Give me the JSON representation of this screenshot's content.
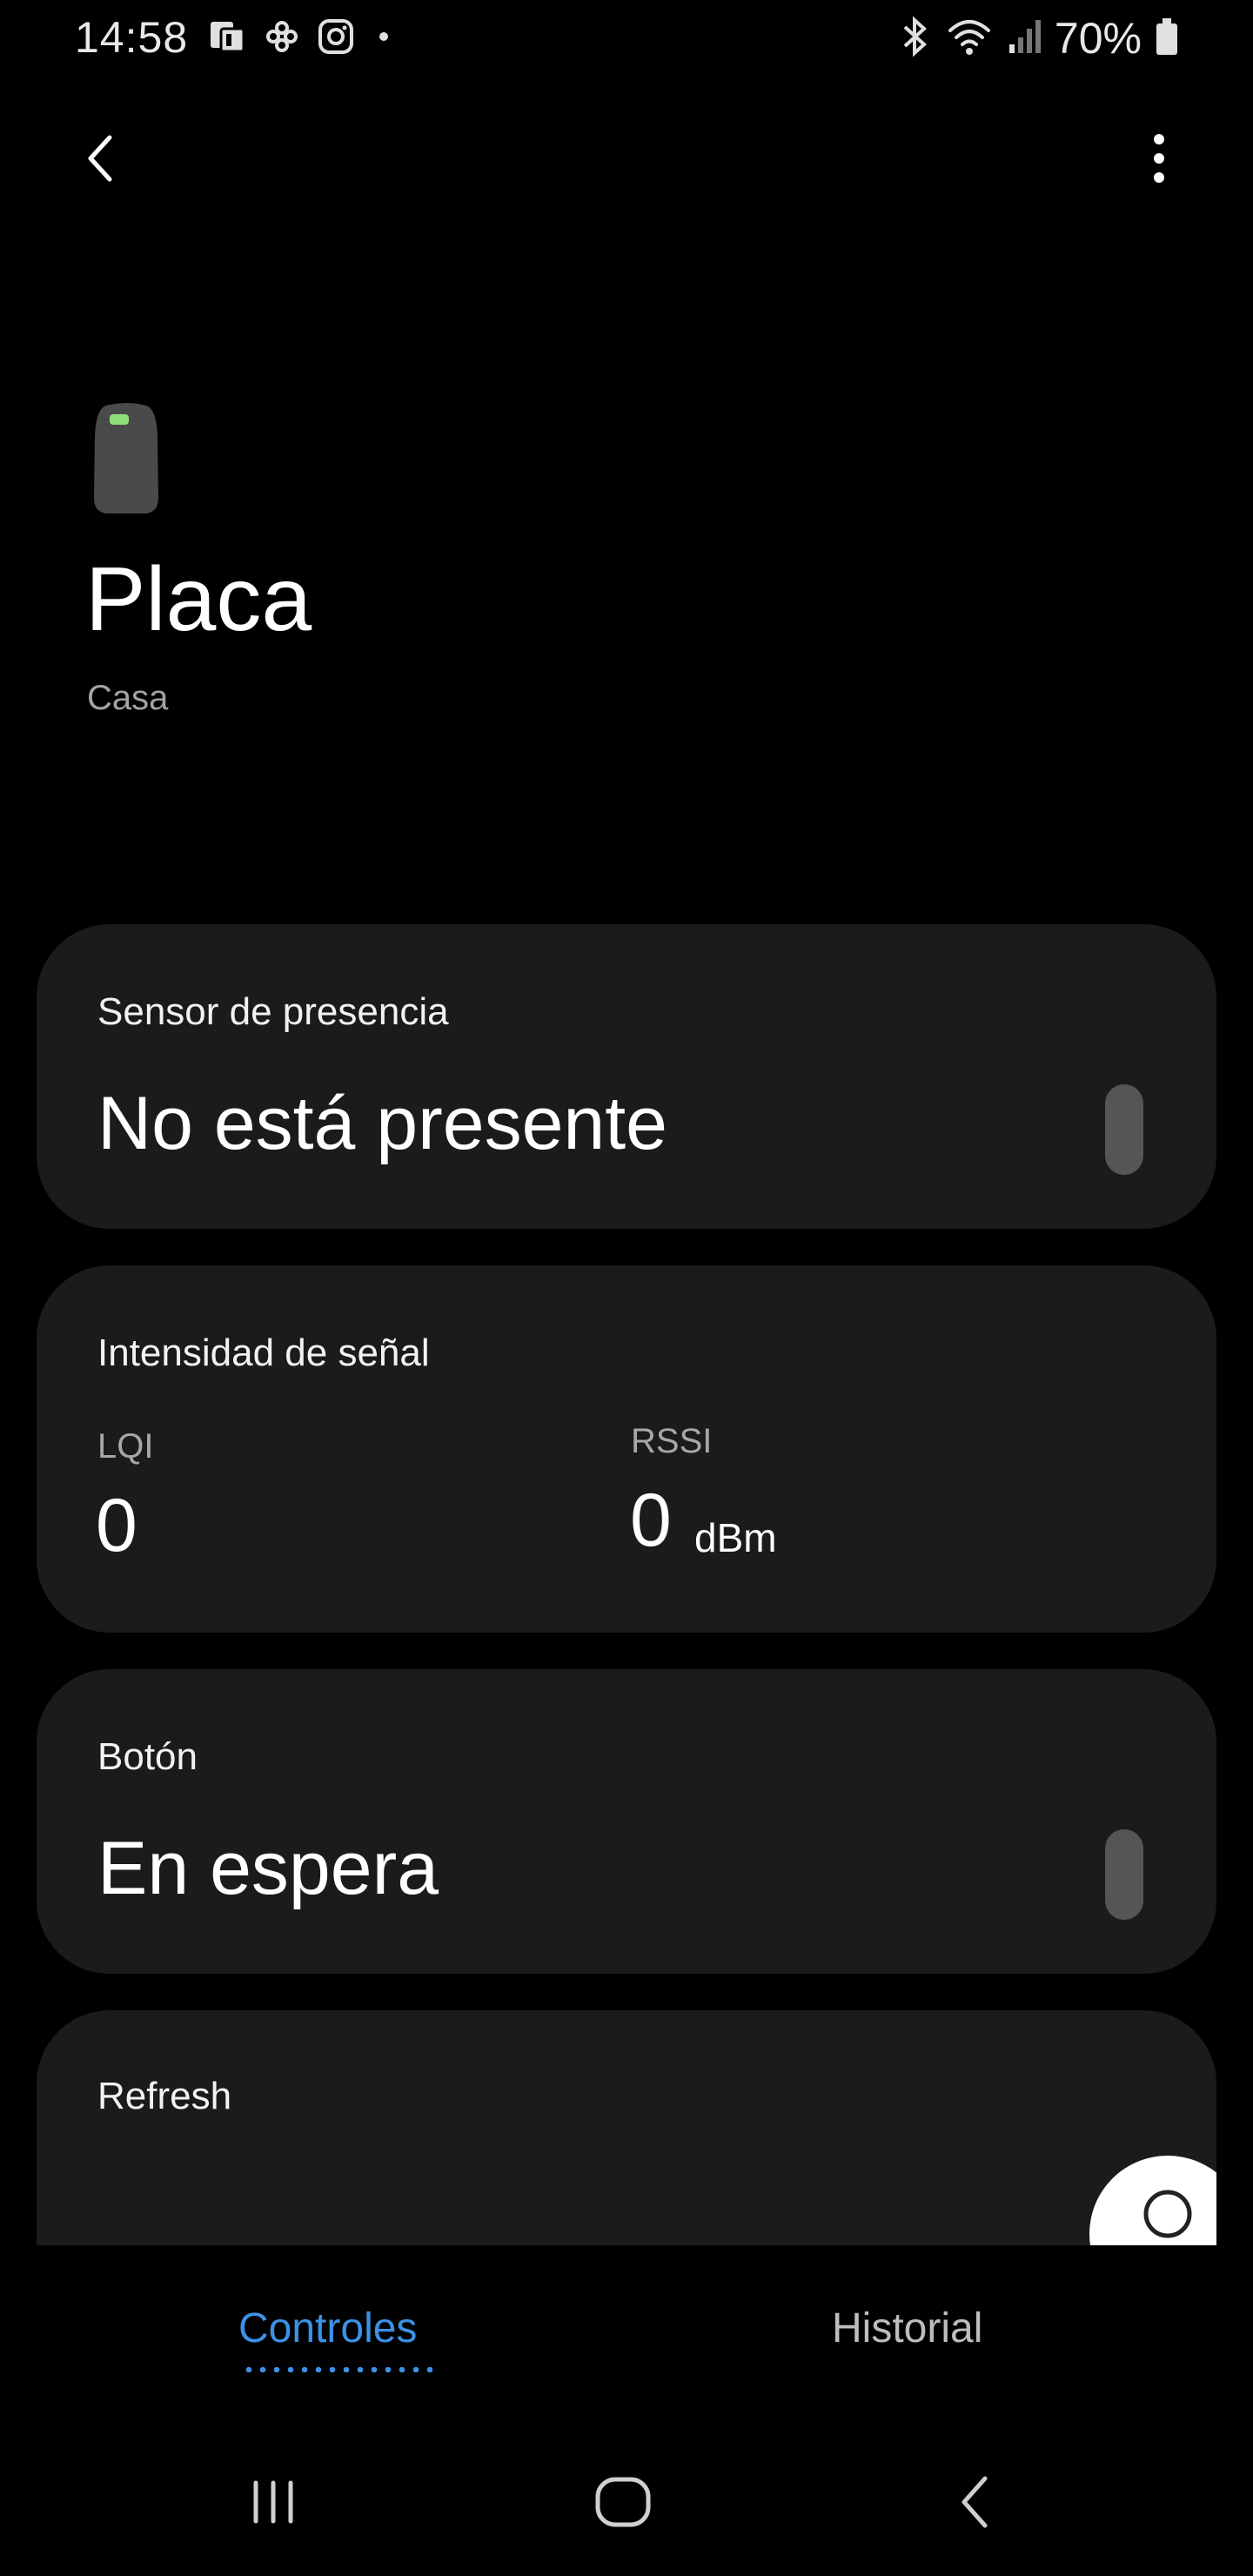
{
  "status_bar": {
    "time": "14:58",
    "battery": "70%",
    "left_icons": [
      "message-app-icon",
      "flower-app-icon",
      "instagram-icon",
      "notification-dot-icon"
    ],
    "right_icons": [
      "bluetooth-icon",
      "wifi-icon",
      "signal-icon",
      "battery-icon"
    ]
  },
  "device": {
    "name": "Placa",
    "room": "Casa"
  },
  "cards": {
    "presence": {
      "label": "Sensor de presencia",
      "value": "No está presente"
    },
    "signal": {
      "label": "Intensidad de señal",
      "lqi_label": "LQI",
      "lqi_value": "0",
      "rssi_label": "RSSI",
      "rssi_value": "0",
      "rssi_unit": "dBm"
    },
    "button": {
      "label": "Botón",
      "value": "En espera"
    },
    "refresh": {
      "label": "Refresh"
    }
  },
  "tabs": [
    {
      "label": "Controles",
      "active": true
    },
    {
      "label": "Historial",
      "active": false
    }
  ],
  "colors": {
    "accent": "#3e91e6",
    "card_bg": "#1b1b1b",
    "background": "#000000",
    "device_led": "#8fe07a"
  }
}
